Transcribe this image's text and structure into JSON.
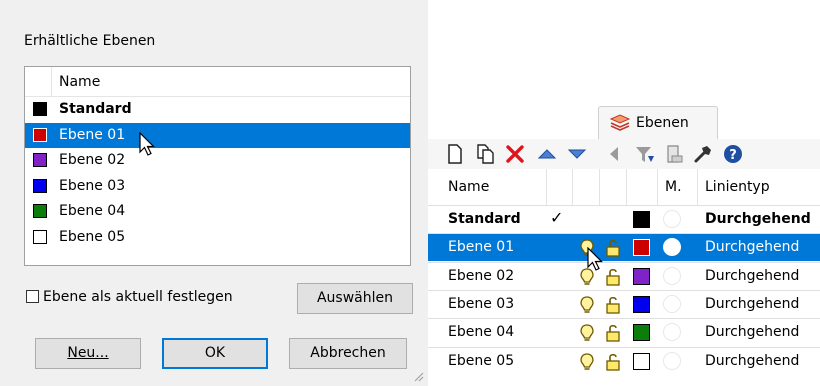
{
  "dialog": {
    "title": "Erhältliche Ebenen",
    "column_name": "Name",
    "layers": [
      {
        "name": "Standard",
        "color": "#000000",
        "bold": true,
        "selected": false
      },
      {
        "name": "Ebene 01",
        "color": "#cc0000",
        "bold": false,
        "selected": true
      },
      {
        "name": "Ebene 02",
        "color": "#7f22c8",
        "bold": false,
        "selected": false
      },
      {
        "name": "Ebene 03",
        "color": "#0000ee",
        "bold": false,
        "selected": false
      },
      {
        "name": "Ebene 04",
        "color": "#0a7d0a",
        "bold": false,
        "selected": false
      },
      {
        "name": "Ebene 05",
        "color": "#ffffff",
        "bold": false,
        "selected": false
      }
    ],
    "checkbox_label": "Ebene als aktuell festlegen",
    "checkbox_checked": false,
    "buttons": {
      "select": "Auswählen",
      "new": "Neu...",
      "ok": "OK",
      "cancel": "Abbrechen"
    }
  },
  "panel": {
    "tab_label": "Ebenen",
    "toolbar_icons": [
      "new-layer-icon",
      "new-sublayer-icon",
      "delete-icon",
      "move-up-icon",
      "move-down-icon",
      "move-out-icon",
      "filter-icon",
      "layer-state-icon",
      "tools-icon",
      "help-icon"
    ],
    "columns": {
      "name": "Name",
      "material": "M.",
      "linetype": "Linientyp"
    },
    "rows": [
      {
        "name": "Standard",
        "current": true,
        "color": "#000000",
        "linetype": "Durchgehend",
        "bold": true,
        "selected": false,
        "show_icons": false
      },
      {
        "name": "Ebene 01",
        "current": false,
        "color": "#cc0000",
        "linetype": "Durchgehend",
        "bold": false,
        "selected": true,
        "show_icons": true
      },
      {
        "name": "Ebene 02",
        "current": false,
        "color": "#7f22c8",
        "linetype": "Durchgehend",
        "bold": false,
        "selected": false,
        "show_icons": true
      },
      {
        "name": "Ebene 03",
        "current": false,
        "color": "#0000ee",
        "linetype": "Durchgehend",
        "bold": false,
        "selected": false,
        "show_icons": true
      },
      {
        "name": "Ebene 04",
        "current": false,
        "color": "#0a7d0a",
        "linetype": "Durchgehend",
        "bold": false,
        "selected": false,
        "show_icons": true
      },
      {
        "name": "Ebene 05",
        "current": false,
        "color": "#ffffff",
        "linetype": "Durchgehend",
        "bold": false,
        "selected": false,
        "show_icons": true
      }
    ],
    "current_mark": "✓"
  },
  "colors": {
    "selection": "#0078d7",
    "button_default_border": "#0078d7"
  }
}
